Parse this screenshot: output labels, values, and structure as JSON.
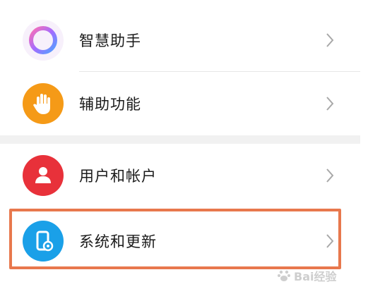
{
  "settings": {
    "items": [
      {
        "label": "智慧助手",
        "icon": "assistant-ring-icon"
      },
      {
        "label": "辅助功能",
        "icon": "hand-icon",
        "color": "#f59a17"
      },
      {
        "label": "用户和帐户",
        "icon": "user-icon",
        "color": "#e8313a"
      },
      {
        "label": "系统和更新",
        "icon": "phone-gear-icon",
        "color": "#1aa0e8"
      }
    ],
    "highlight_color": "#e8784d"
  },
  "watermark": {
    "text": "Bai经验"
  }
}
